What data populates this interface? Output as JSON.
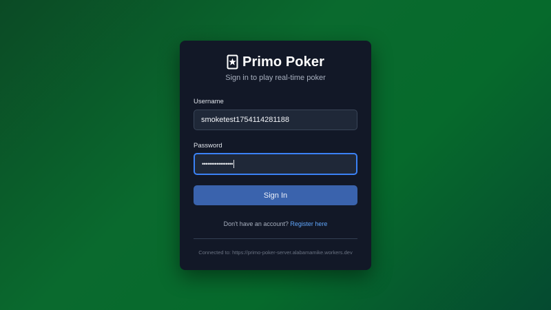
{
  "brand": {
    "icon": "playing-card-star-icon",
    "title": "Primo Poker",
    "subtitle": "Sign in to play real-time poker"
  },
  "form": {
    "username": {
      "label": "Username",
      "value": "smoketest1754114281188"
    },
    "password": {
      "label": "Password",
      "masked_value": "•••••••••••••••••"
    },
    "submit_label": "Sign In"
  },
  "register": {
    "prompt": "Don't have an account?",
    "link_label": "Register here"
  },
  "footer": {
    "connection_text": "Connected to: https://primo-poker-server.alabamamike.workers.dev"
  },
  "colors": {
    "card_bg": "#121827",
    "accent_button": "#3a63ad",
    "focus_border": "#3b82f6",
    "link": "#60a5fa",
    "background_green": "#0a6a2e"
  }
}
